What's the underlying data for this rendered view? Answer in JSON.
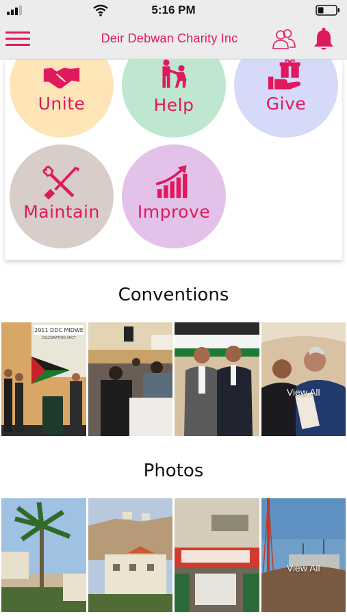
{
  "status_bar": {
    "time": "5:16 PM"
  },
  "header": {
    "title": "Deir Debwan Charity Inc"
  },
  "categories": [
    {
      "label": "Unite",
      "color": "#fde5b8"
    },
    {
      "label": "Help",
      "color": "#bfe6cf"
    },
    {
      "label": "Give",
      "color": "#d4daf8"
    },
    {
      "label": "Maintain",
      "color": "#d8cdc9"
    },
    {
      "label": "Improve",
      "color": "#e3c2e9"
    }
  ],
  "sections": {
    "conventions": {
      "title": "Conventions",
      "view_all_label": "View All"
    },
    "photos": {
      "title": "Photos",
      "view_all_label": "View All"
    }
  },
  "photo_banner_text": "2011 DDC MIDWE",
  "photo_banner_sub": "CELEBRATING ARCT",
  "accent_color": "#e0195f"
}
